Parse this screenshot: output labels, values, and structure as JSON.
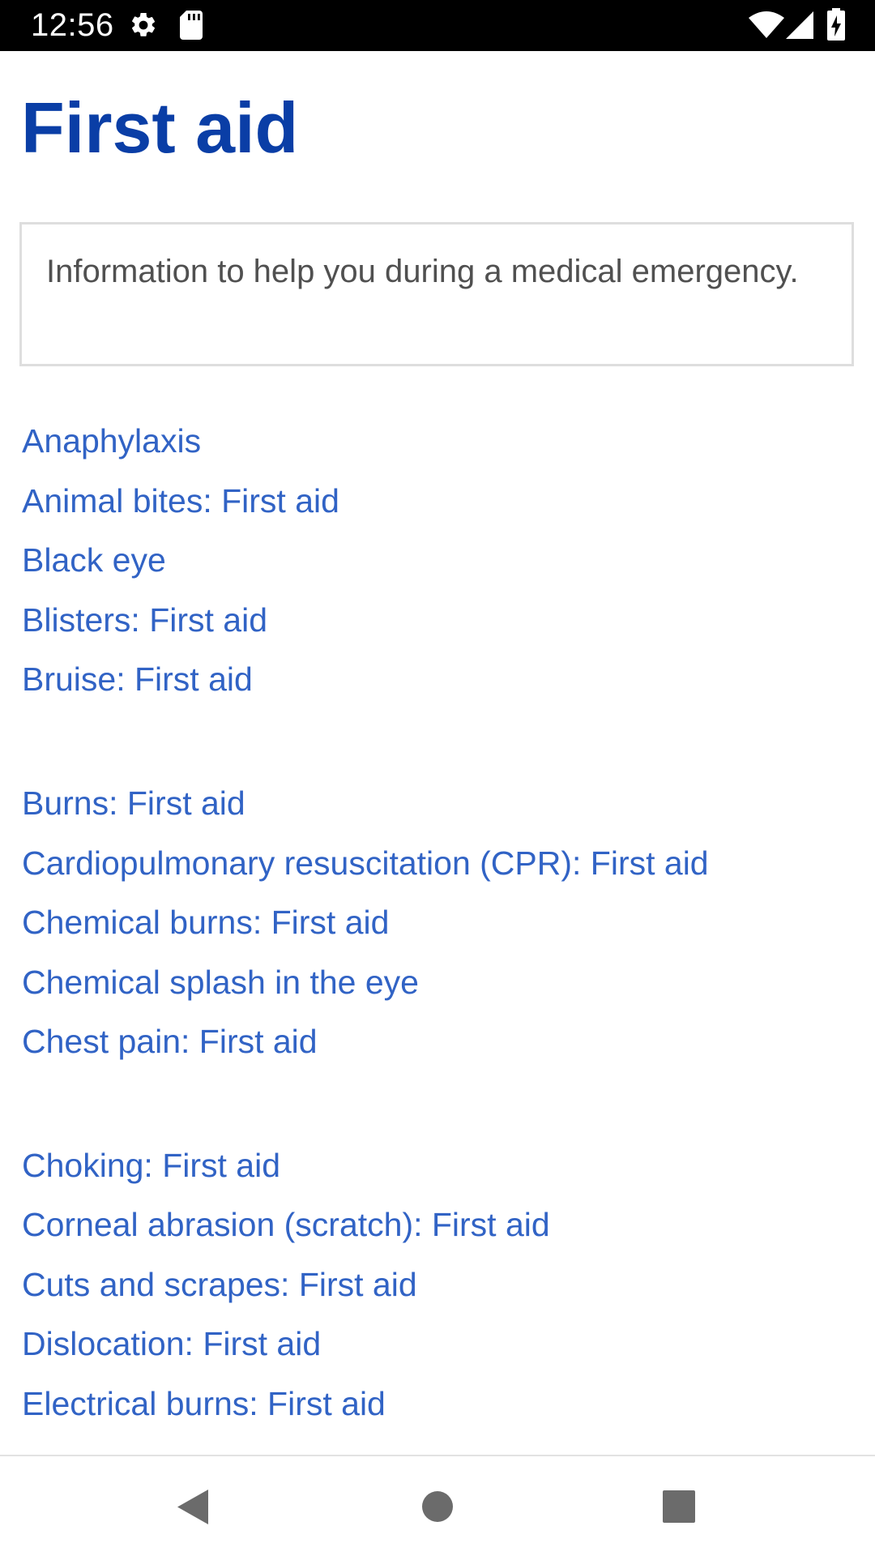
{
  "status_bar": {
    "time": "12:56",
    "icons": [
      "gear-icon",
      "sd-card-icon",
      "wifi-icon",
      "cell-signal-icon",
      "battery-charging-icon"
    ]
  },
  "page": {
    "title": "First aid",
    "intro": "Information to help you during a medical emergency."
  },
  "links": [
    "Anaphylaxis",
    "Animal bites: First aid",
    "Black eye",
    "Blisters: First aid",
    "Bruise: First aid",
    "Burns: First aid",
    "Cardiopulmonary resuscitation (CPR): First aid",
    "Chemical burns: First aid",
    "Chemical splash in the eye",
    "Chest pain: First aid",
    "Choking: First aid",
    "Corneal abrasion (scratch): First aid",
    "Cuts and scrapes: First aid",
    "Dislocation: First aid",
    "Electrical burns: First aid"
  ],
  "nav_bar": {
    "icons": [
      "back-icon",
      "home-icon",
      "recents-icon"
    ]
  },
  "colors": {
    "title": "#0a3ea6",
    "link": "#3163c5",
    "intro_text": "#505050",
    "status_bar_bg": "#000000"
  }
}
